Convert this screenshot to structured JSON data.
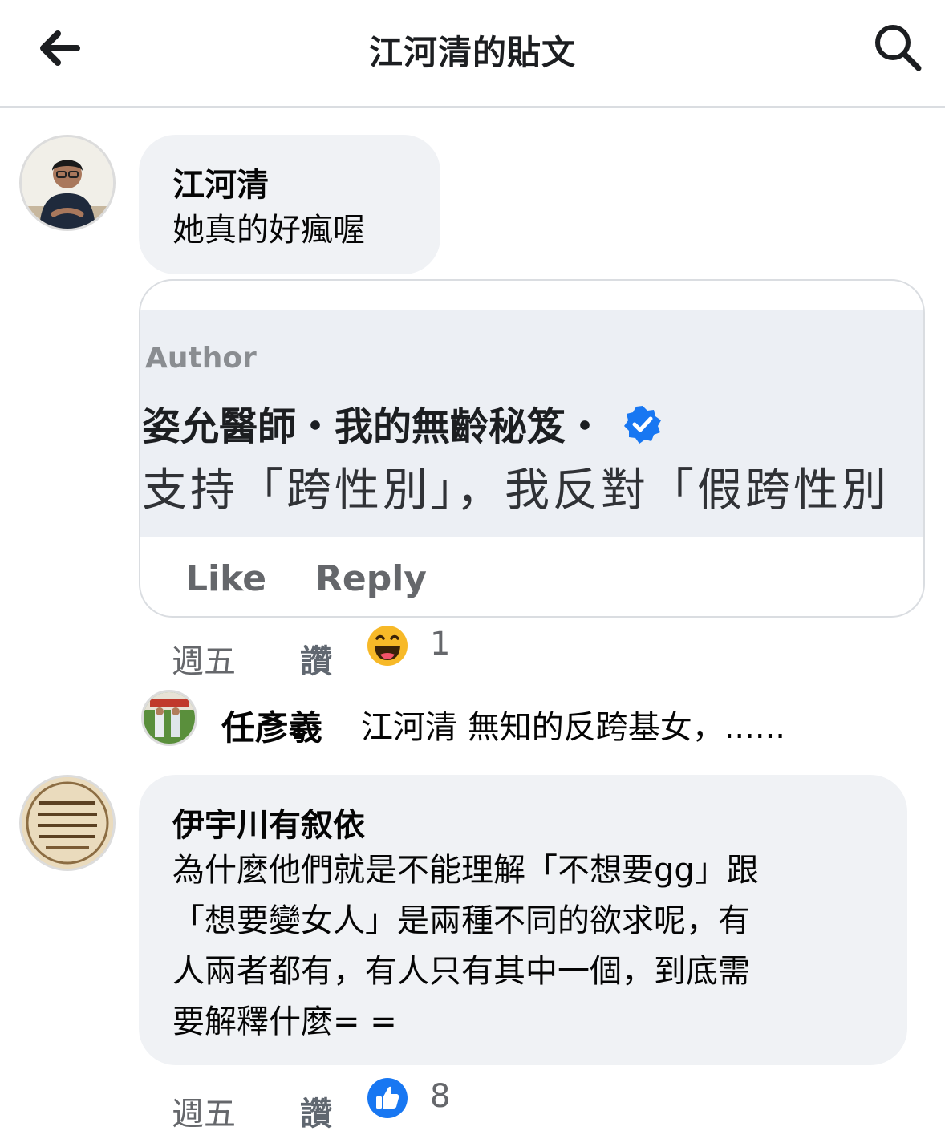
{
  "header": {
    "title": "江河清的貼文"
  },
  "comment1": {
    "author": "江河清",
    "text": "她真的好瘋喔",
    "screenshot": {
      "tag": "Author",
      "name": "姿允醫師・我的無齡秘笈・",
      "text": "支持「跨性別」，我反對「假跨性別",
      "like": "Like",
      "reply": "Reply",
      "verified_color": "#1877f2"
    },
    "time": "週五",
    "like_label": "讚",
    "reaction": "haha-icon",
    "reaction_count": "1"
  },
  "reply": {
    "author": "任彥羲",
    "text": "江河清 無知的反跨基女，......"
  },
  "comment2": {
    "author": "伊宇川有叙依",
    "lines": [
      "為什麼他們就是不能理解「不想要gg」跟",
      "「想要變女人」是兩種不同的欲求呢，有",
      "人兩者都有，有人只有其中一個，到底需",
      "要解釋什麼= ="
    ],
    "time": "週五",
    "like_label": "讚",
    "reaction": "like-icon",
    "reaction_count": "8"
  },
  "colors": {
    "bubble": "#f0f2f5",
    "meta": "#65676b",
    "like_blue": "#1877f2",
    "haha_yellow": "#f7b928"
  }
}
